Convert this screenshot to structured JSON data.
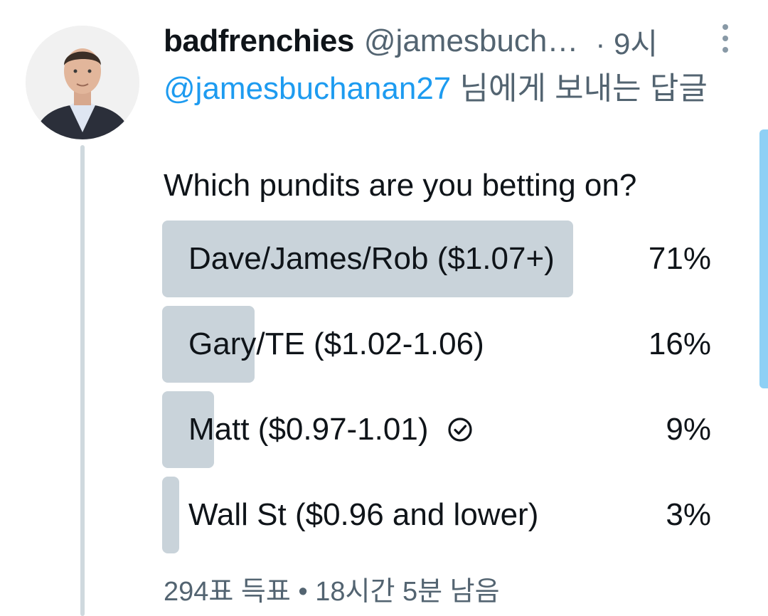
{
  "tweet": {
    "author": {
      "display_name": "badfrenchies",
      "handle": "@jamesbuch…",
      "avatar_icon": "profile-photo"
    },
    "timestamp": "· 9시",
    "reply_context": {
      "mention": "@jamesbuchanan27",
      "suffix": " 님에게 보내는 답글"
    },
    "text": "Which pundits are you betting on?",
    "poll": {
      "options": [
        {
          "label": "Dave/James/Rob ($1.07+)",
          "percent_text": "71%",
          "percent": 71,
          "selected": false
        },
        {
          "label": "Gary/TE ($1.02-1.06)",
          "percent_text": "16%",
          "percent": 16,
          "selected": false
        },
        {
          "label": "Matt ($0.97-1.01)",
          "percent_text": "9%",
          "percent": 9,
          "selected": true
        },
        {
          "label": "Wall St ($0.96 and lower)",
          "percent_text": "3%",
          "percent": 3,
          "selected": false
        }
      ],
      "footer": "294표 득표 • 18시간 5분 남음"
    }
  },
  "colors": {
    "accent": "#1d9bf0",
    "secondary_text": "#536471",
    "poll_bar": "#c9d3da",
    "thread_line": "#cfd9de"
  }
}
